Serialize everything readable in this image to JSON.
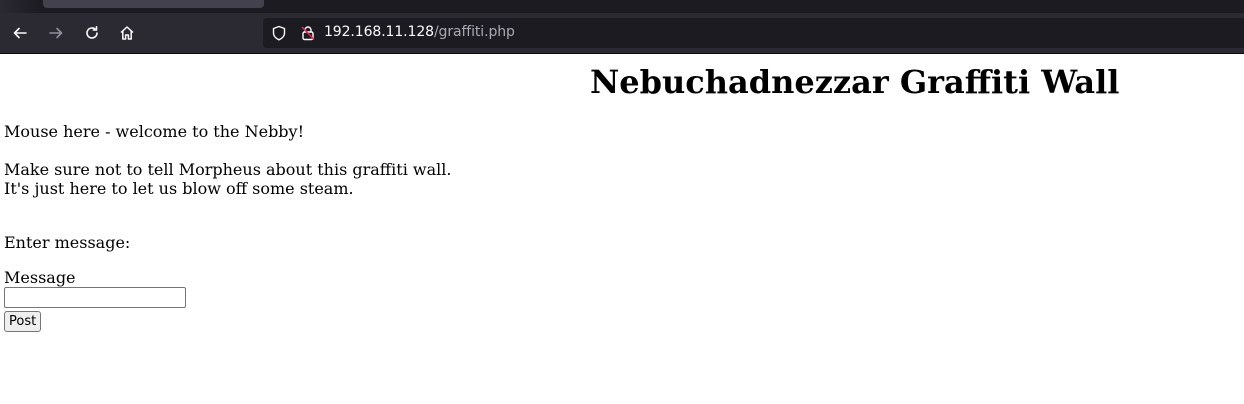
{
  "browser": {
    "url_host": "192.168.11.128",
    "url_path": "/graffiti.php",
    "icons": [
      "back-arrow-icon",
      "forward-arrow-icon",
      "reload-icon",
      "home-icon",
      "shield-icon",
      "lock-icon"
    ]
  },
  "page": {
    "title": "Nebuchadnezzar Graffiti Wall",
    "posts": [
      "Mouse here - welcome to the Nebby!",
      "Make sure not to tell Morpheus about this graffiti wall.",
      "It's just here to let us blow off some steam."
    ],
    "form": {
      "prompt": "Enter message:",
      "field_label": "Message",
      "field_value": "",
      "submit_label": "Post"
    }
  }
}
